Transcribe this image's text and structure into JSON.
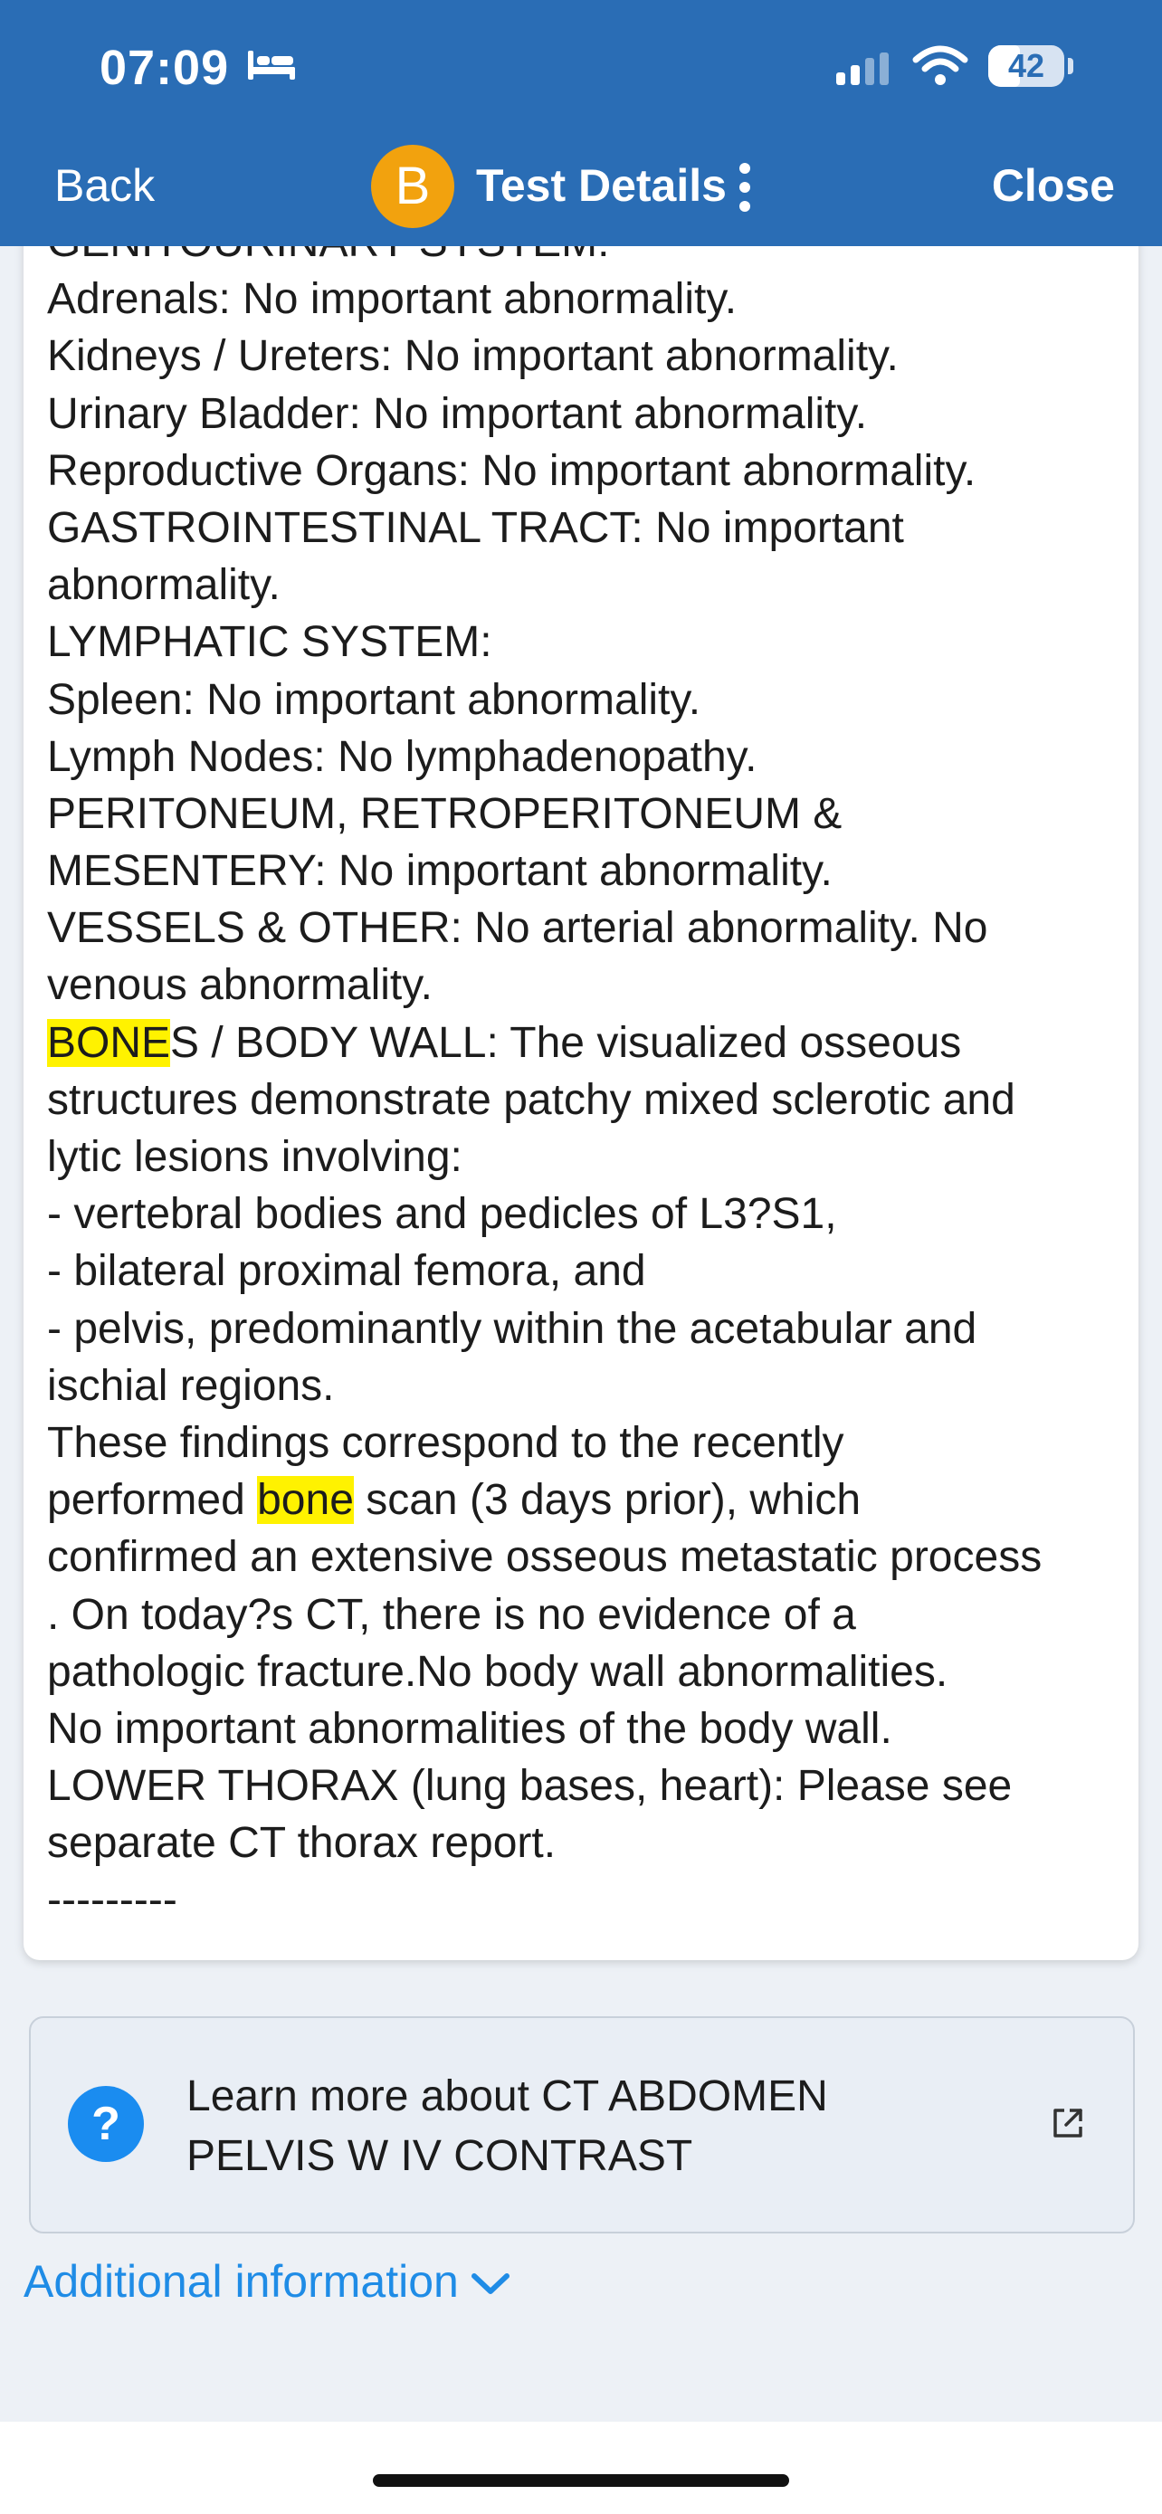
{
  "status_bar": {
    "time": "07:09",
    "battery": "42",
    "battery_level_percent": 42
  },
  "nav": {
    "back_label": "Back",
    "avatar_initial": "B",
    "title": "Test Details",
    "close_label": "Close"
  },
  "report": {
    "lines": [
      "GENITOURINARY SYSTEM:",
      "Adrenals: No important abnormality.",
      "Kidneys / Ureters: No important abnormality.",
      "Urinary Bladder: No important abnormality.",
      "Reproductive Organs: No important abnormality.",
      "GASTROINTESTINAL TRACT: No important",
      "abnormality.",
      "LYMPHATIC SYSTEM:",
      "Spleen: No important abnormality.",
      "Lymph Nodes: No lymphadenopathy.",
      "PERITONEUM, RETROPERITONEUM &",
      "MESENTERY: No important abnormality.",
      "VESSELS & OTHER: No arterial abnormality. No",
      "venous abnormality.",
      "BONES / BODY WALL: The visualized osseous",
      "structures demonstrate patchy mixed sclerotic and",
      "lytic lesions involving:",
      "- vertebral bodies and pedicles of L3?S1,",
      "- bilateral proximal femora, and",
      "- pelvis, predominantly within the acetabular and",
      "ischial regions.",
      "These findings correspond to the recently",
      "performed bone scan (3 days prior), which",
      "confirmed an extensive osseous metastatic process",
      ". On today?s CT, there is no evidence of a",
      "pathologic fracture.No body wall abnormalities.",
      "No important abnormalities of the body wall.",
      "LOWER THORAX (lung bases, heart): Please see",
      "separate CT thorax report.",
      "---------"
    ],
    "bones_line_highlight": "BONE",
    "bones_line_rest": "S / BODY WALL: The visualized osseous",
    "bone_scan_line_before": "performed ",
    "bone_scan_line_highlight": "bone",
    "bone_scan_line_after": " scan (3 days prior), which"
  },
  "learn_more": {
    "line1": "Learn more about CT ABDOMEN",
    "line2": "PELVIS W IV CONTRAST"
  },
  "additional": {
    "label": "Additional information"
  },
  "icons": {
    "bed": "bed-icon",
    "signal": "signal-icon",
    "wifi": "wifi-icon",
    "more": "more-vertical-icon",
    "help": "help-icon",
    "external_link": "external-link-icon",
    "chevron": "chevron-down-icon"
  },
  "colors": {
    "header": "#2a6db5",
    "avatar": "#f2a20e",
    "highlight": "#fff200",
    "link": "#1f8ce6",
    "help_icon": "#1a8cf0"
  }
}
